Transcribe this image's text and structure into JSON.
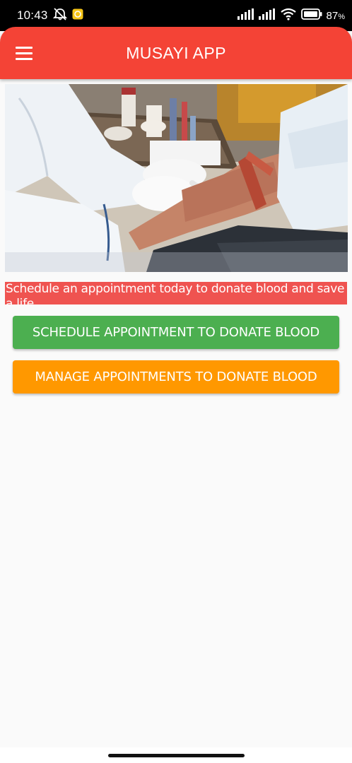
{
  "status_bar": {
    "time": "10:43",
    "battery_percent": "87",
    "battery_suffix": "%",
    "icons": [
      "muted-notification-icon",
      "app-notification-icon",
      "signal-icon",
      "signal-icon",
      "wifi-icon",
      "battery-icon"
    ]
  },
  "app_bar": {
    "title": "MUSAYI APP",
    "menu_icon": "hamburger-menu-icon",
    "color": "#f44336"
  },
  "hero_image": {
    "description_icon": "blood-donation-photo"
  },
  "banner": {
    "text": "Schedule an appointment today to donate blood and save a life",
    "color": "#ef5350"
  },
  "buttons": {
    "schedule": {
      "label": "SCHEDULE APPOINTMENT TO DONATE BLOOD",
      "color": "#4caf50"
    },
    "manage": {
      "label": "MANAGE APPOINTMENTS TO DONATE BLOOD",
      "color": "#ff9800"
    }
  }
}
